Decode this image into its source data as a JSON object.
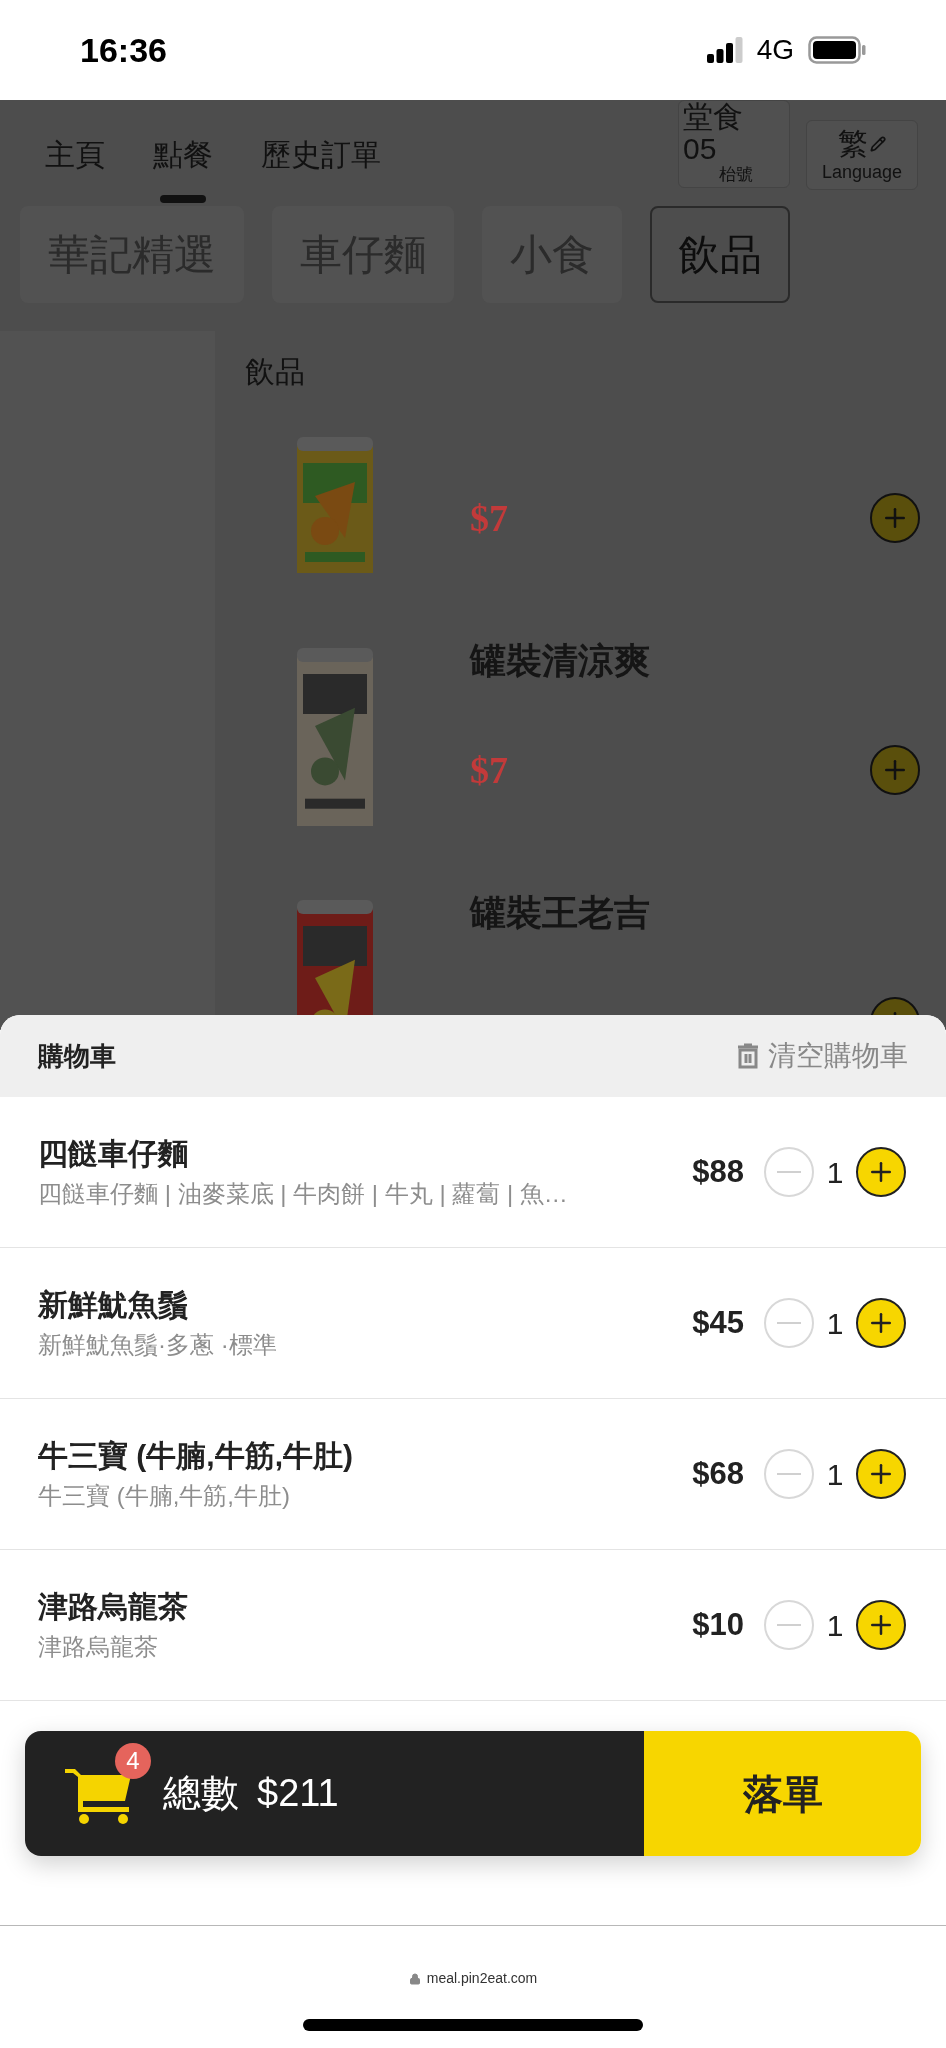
{
  "status_bar": {
    "time": "16:36",
    "network": "4G"
  },
  "nav": {
    "tabs": [
      {
        "label": "主頁",
        "selected": false
      },
      {
        "label": "點餐",
        "selected": true
      },
      {
        "label": "歷史訂單",
        "selected": false
      }
    ],
    "dine_mode": {
      "label": "堂食",
      "table": "05",
      "table_label": "枱號"
    },
    "language": {
      "label": "繁",
      "caption": "Language"
    }
  },
  "categories": [
    {
      "label": "華記精選",
      "selected": false
    },
    {
      "label": "車仔麵",
      "selected": false
    },
    {
      "label": "小食",
      "selected": false
    },
    {
      "label": "飲品",
      "selected": true
    }
  ],
  "menu": {
    "section_title": "飲品",
    "products": [
      {
        "price": "$7"
      },
      {
        "name": "罐裝清涼爽",
        "price": "$7"
      },
      {
        "name": "罐裝王老吉"
      }
    ]
  },
  "cart": {
    "title": "購物車",
    "clear_label": "清空購物車",
    "items": [
      {
        "name": "四餸車仔麵",
        "details": "四餸車仔麵 | 油麥菜底 | 牛肉餅 | 牛丸 | 蘿蔔 | 魚…",
        "price": "$88",
        "quantity": "1"
      },
      {
        "name": "新鮮魷魚鬚",
        "details": "新鮮魷魚鬚·多蔥 ·標準",
        "price": "$45",
        "quantity": "1"
      },
      {
        "name": "牛三寶 (牛腩,牛筋,牛肚)",
        "details": "牛三寶 (牛腩,牛筋,牛肚)",
        "price": "$68",
        "quantity": "1"
      },
      {
        "name": "津路烏龍茶",
        "details": "津路烏龍茶",
        "price": "$10",
        "quantity": "1"
      }
    ]
  },
  "checkout": {
    "badge": "4",
    "total_label": "總數",
    "total": "$211",
    "submit_label": "落單"
  },
  "browser": {
    "url": "meal.pin2eat.com"
  }
}
